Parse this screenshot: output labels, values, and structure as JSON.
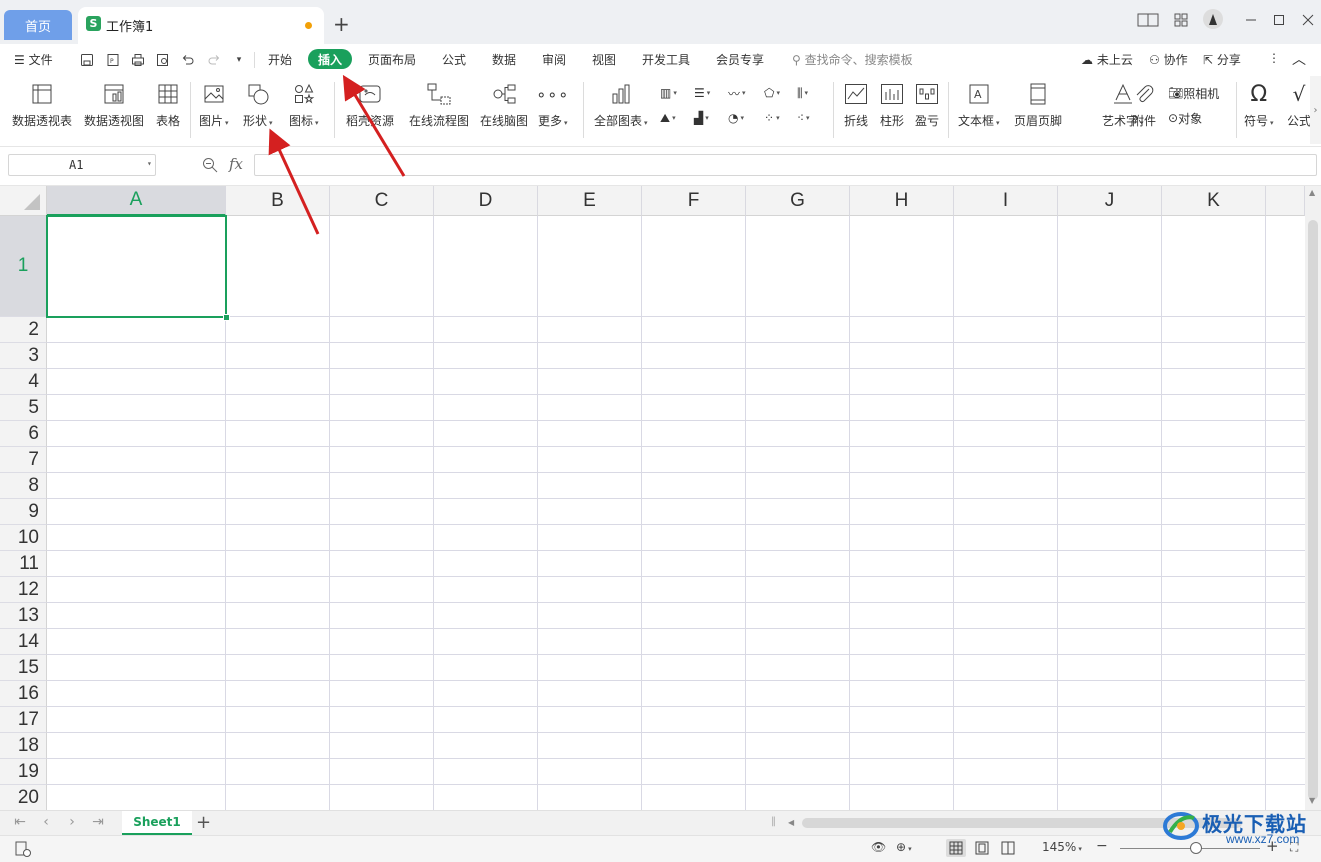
{
  "tabs": {
    "home": "首页",
    "document": "工作簿1",
    "new_tab": "+"
  },
  "window": {
    "buttons": [
      "layout-icon",
      "grid-apps-icon",
      "avatar",
      "minimize-icon",
      "maximize-icon",
      "close-icon"
    ]
  },
  "menu": {
    "file": "文件",
    "items": [
      "开始",
      "插入",
      "页面布局",
      "公式",
      "数据",
      "审阅",
      "视图",
      "开发工具",
      "会员专享"
    ],
    "active": "插入",
    "search_placeholder": "查找命令、搜索模板",
    "cloud": "未上云",
    "collaborate": "协作",
    "share": "分享"
  },
  "ribbon": {
    "pivot_table": "数据透视表",
    "pivot_chart": "数据透视图",
    "table": "表格",
    "picture": "图片",
    "shape": "形状",
    "icon": "图标",
    "docer": "稻壳资源",
    "flowchart": "在线流程图",
    "mindmap": "在线脑图",
    "more": "更多",
    "all_charts": "全部图表",
    "line": "折线",
    "column": "柱形",
    "winloss": "盈亏",
    "textbox": "文本框",
    "header_footer": "页眉页脚",
    "wordart": "艺术字",
    "attachment": "附件",
    "camera": "照相机",
    "object": "对象",
    "symbol": "符号",
    "formula": "公式"
  },
  "formula_bar": {
    "name_box": "A1",
    "fx": "fx",
    "value": ""
  },
  "grid": {
    "columns": [
      "A",
      "B",
      "C",
      "D",
      "E",
      "F",
      "G",
      "H",
      "I",
      "J",
      "K"
    ],
    "rows": [
      "1",
      "2",
      "3",
      "4",
      "5",
      "6",
      "7",
      "8",
      "9",
      "10",
      "11",
      "12",
      "13",
      "14",
      "15",
      "16",
      "17",
      "18",
      "19",
      "20"
    ],
    "active_cell": "A1"
  },
  "sheets": {
    "tabs": [
      "Sheet1"
    ],
    "active": "Sheet1",
    "add": "+"
  },
  "status": {
    "zoom": "145%",
    "zoom_minus": "−",
    "zoom_plus": "+"
  },
  "watermark": {
    "text": "极光下载站",
    "url": "www.xz7.com"
  },
  "colors": {
    "accent": "#1aa05c",
    "home_tab": "#6f9fe9",
    "annotation_arrow": "#d42020"
  }
}
